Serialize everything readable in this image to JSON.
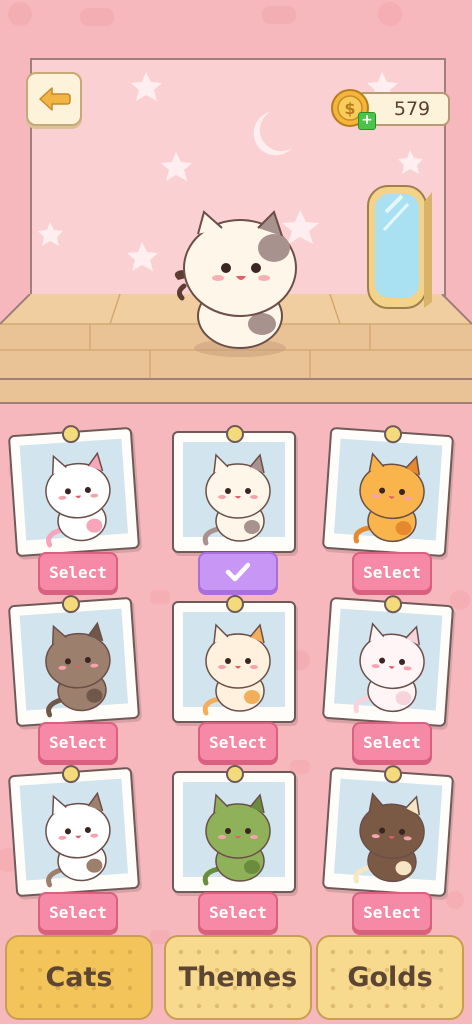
{
  "colors": {
    "background": "#f6b8bd",
    "wall": "#fbd0d3",
    "floor": "#e9c296",
    "select_button": "#f689a6",
    "selected_button": "#c896f5",
    "tab": "#f8da8e"
  },
  "header": {
    "back_icon": "arrow-left-icon",
    "coins": "579",
    "coin_icon": "coin-icon",
    "add_icon": "plus-icon"
  },
  "cats": [
    {
      "name": "white-pink-cat",
      "button": "Select",
      "state": "select",
      "fur": "#ffffff",
      "patch": "#f6a5ba",
      "ear": "#f6c4cf"
    },
    {
      "name": "calico-cat",
      "button": "",
      "state": "selected",
      "fur": "#fff6ea",
      "patch": "#a8928e",
      "ear": "#f6c4cf"
    },
    {
      "name": "orange-tabby-cat",
      "button": "Select",
      "state": "select",
      "fur": "#f9b54b",
      "patch": "#e6892e",
      "ear": "#f8a3a7"
    },
    {
      "name": "brown-cat",
      "button": "Select",
      "state": "select",
      "fur": "#9c7f6c",
      "patch": "#6f574a",
      "ear": "#f6c4cf"
    },
    {
      "name": "cream-cat",
      "button": "Select",
      "state": "select",
      "fur": "#fff1dd",
      "patch": "#f3ae5c",
      "ear": "#f6c4cf"
    },
    {
      "name": "fluffy-white-cat",
      "button": "Select",
      "state": "select",
      "fur": "#fff5f7",
      "patch": "#f7d3dc",
      "ear": "#f6c4cf"
    },
    {
      "name": "astronaut-cat",
      "button": "Select",
      "state": "select",
      "fur": "#ffffff",
      "patch": "#9c7f6c",
      "ear": "#f6c4cf"
    },
    {
      "name": "cactus-cat",
      "button": "Select",
      "state": "select",
      "fur": "#8fb15a",
      "patch": "#6a8d3d",
      "ear": "#f6c4cf"
    },
    {
      "name": "cake-cat",
      "button": "Select",
      "state": "select",
      "fur": "#7a5a44",
      "patch": "#f7e6c4",
      "ear": "#f6c4cf"
    }
  ],
  "tabs": [
    {
      "label": "Cats",
      "active": true
    },
    {
      "label": "Themes",
      "active": false
    },
    {
      "label": "Golds",
      "active": false
    }
  ],
  "selected_icon": "checkmark-icon"
}
